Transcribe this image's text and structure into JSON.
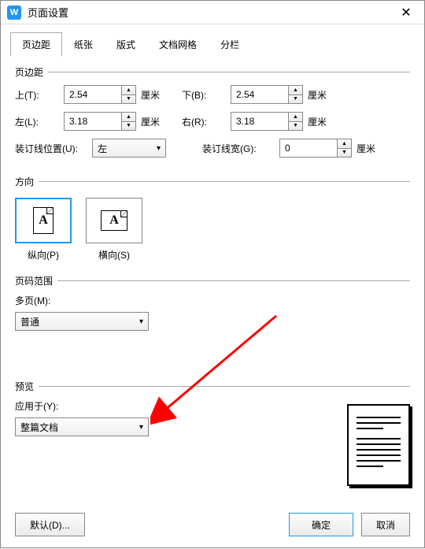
{
  "title": "页面设置",
  "tabs": [
    "页边距",
    "纸张",
    "版式",
    "文档网格",
    "分栏"
  ],
  "margins": {
    "groupLabel": "页边距",
    "topLabel": "上(T):",
    "topValue": "2.54",
    "topUnit": "厘米",
    "bottomLabel": "下(B):",
    "bottomValue": "2.54",
    "bottomUnit": "厘米",
    "leftLabel": "左(L):",
    "leftValue": "3.18",
    "leftUnit": "厘米",
    "rightLabel": "右(R):",
    "rightValue": "3.18",
    "rightUnit": "厘米",
    "gutterPosLabel": "装订线位置(U):",
    "gutterPosValue": "左",
    "gutterWidthLabel": "装订线宽(G):",
    "gutterWidthValue": "0",
    "gutterWidthUnit": "厘米"
  },
  "orientation": {
    "groupLabel": "方向",
    "portraitLabel": "纵向(P)",
    "landscapeLabel": "横向(S)"
  },
  "pageRange": {
    "groupLabel": "页码范围",
    "multiLabel": "多页(M):",
    "multiValue": "普通"
  },
  "preview": {
    "groupLabel": "预览",
    "applyLabel": "应用于(Y):",
    "applyValue": "整篇文档"
  },
  "footer": {
    "defaultLabel": "默认(D)...",
    "okLabel": "确定",
    "cancelLabel": "取消"
  }
}
